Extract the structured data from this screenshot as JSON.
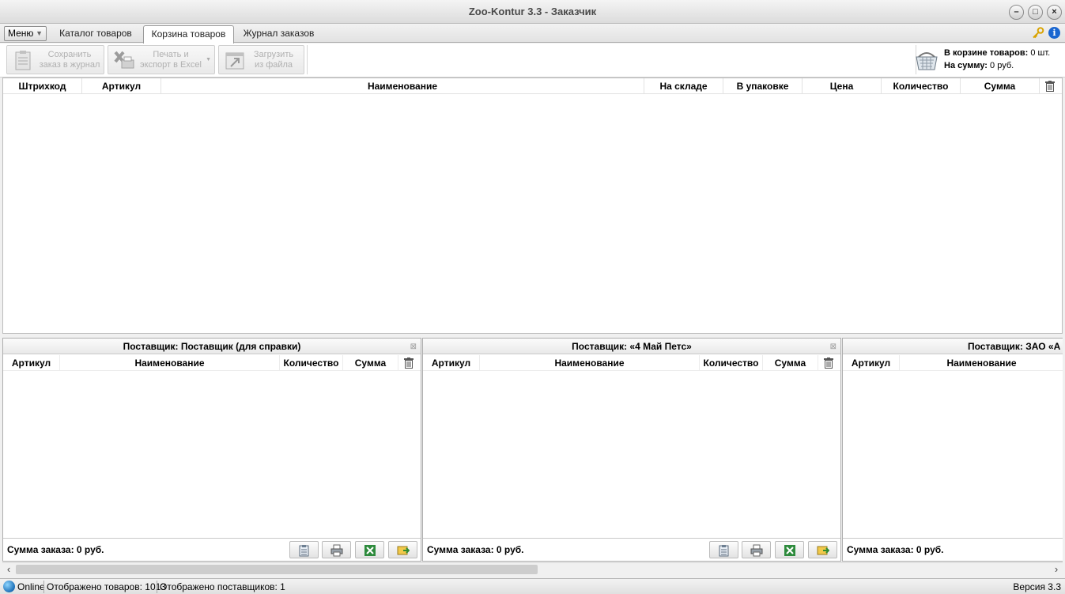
{
  "window": {
    "title": "Zoo-Kontur 3.3 - Заказчик"
  },
  "menu": {
    "label": "Меню"
  },
  "tabs": [
    {
      "label": "Каталог товаров"
    },
    {
      "label": "Корзина товаров"
    },
    {
      "label": "Журнал заказов"
    }
  ],
  "toolbar": {
    "save_line1": "Сохранить",
    "save_line2": "заказ в журнал",
    "print_line1": "Печать и",
    "print_line2": "экспорт в Excel",
    "load_line1": "Загрузить",
    "load_line2": "из файла"
  },
  "cart": {
    "items_label": "В корзине товаров:",
    "items_value": "0 шт.",
    "sum_label": "На сумму:",
    "sum_value": "0 руб."
  },
  "main_grid": {
    "columns": [
      "Штрихкод",
      "Артикул",
      "Наименование",
      "На складе",
      "В упаковке",
      "Цена",
      "Количество",
      "Сумма"
    ]
  },
  "suppliers": [
    {
      "title": "Поставщик: Поставщик (для справки)",
      "columns": [
        "Артикул",
        "Наименование",
        "Количество",
        "Сумма"
      ],
      "total": "Сумма заказа: 0 руб."
    },
    {
      "title": "Поставщик: «4 Май Петс»",
      "columns": [
        "Артикул",
        "Наименование",
        "Количество",
        "Сумма"
      ],
      "total": "Сумма заказа: 0 руб."
    },
    {
      "title": "Поставщик: ЗАО «А",
      "columns": [
        "Артикул",
        "Наименование"
      ],
      "total": "Сумма заказа: 0 руб."
    }
  ],
  "status": {
    "online": "Online",
    "items_shown": "Отображено товаров: 1013",
    "suppliers_shown": "Отображено поставщиков: 1",
    "version": "Версия 3.3"
  }
}
